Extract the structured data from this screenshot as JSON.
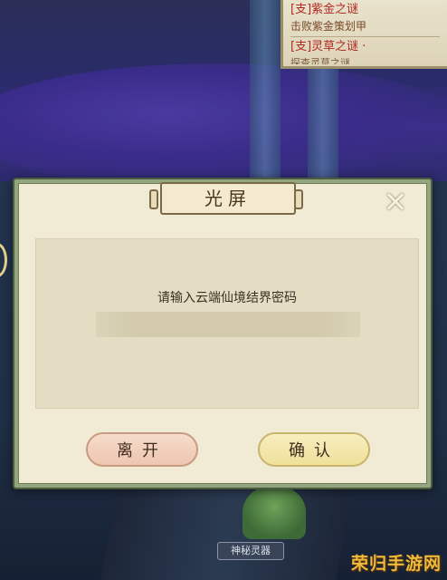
{
  "quest_panel": {
    "line1": "[支]紫金之谜",
    "line2": "击败紫金策划甲",
    "line3": "[支]灵草之谜 ·",
    "line4": "探查灵草之谜"
  },
  "dialog": {
    "title": "光屏",
    "close_icon": "✕",
    "prompt": "请输入云端仙境结界密码",
    "password_value": "",
    "password_placeholder": "",
    "leave_label": "离开",
    "confirm_label": "确认"
  },
  "scene": {
    "bottom_label": "神秘灵器",
    "watermark": "荣归手游网"
  },
  "colors": {
    "dialog_frame": "#93a57e",
    "dialog_paper": "#f1ebd6",
    "leave_button": "#f3d4c0",
    "confirm_button": "#f3e8ae"
  }
}
